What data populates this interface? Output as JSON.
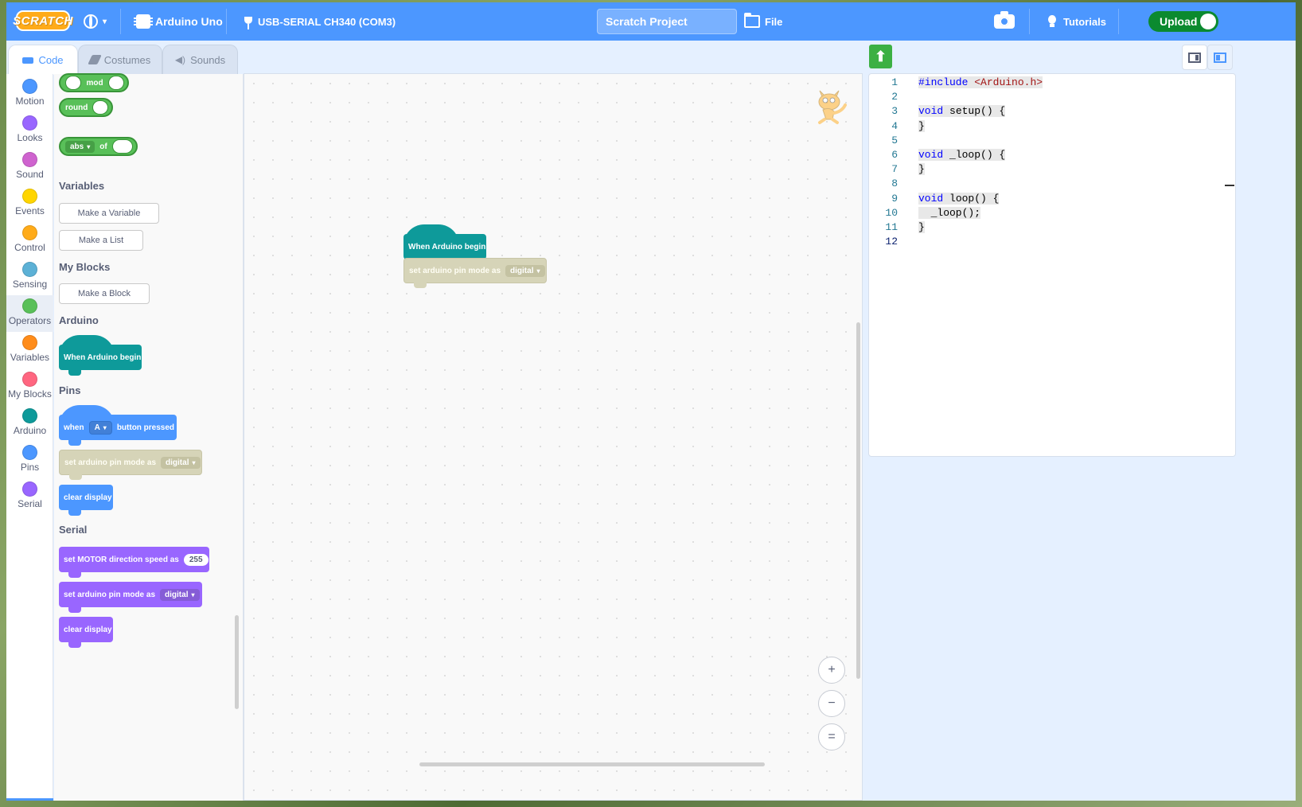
{
  "menu": {
    "logo": "SCRATCH",
    "board": "Arduino Uno",
    "port": "USB-SERIAL CH340 (COM3)",
    "project_title": "Scratch Project",
    "file": "File",
    "tutorials": "Tutorials",
    "upload": "Upload"
  },
  "tabs": {
    "code": "Code",
    "costumes": "Costumes",
    "sounds": "Sounds"
  },
  "categories": [
    {
      "label": "Motion",
      "color": "#4c97ff"
    },
    {
      "label": "Looks",
      "color": "#9966ff"
    },
    {
      "label": "Sound",
      "color": "#cf63cf"
    },
    {
      "label": "Events",
      "color": "#ffd500"
    },
    {
      "label": "Control",
      "color": "#ffab19"
    },
    {
      "label": "Sensing",
      "color": "#5cb1d6"
    },
    {
      "label": "Operators",
      "color": "#59c059"
    },
    {
      "label": "Variables",
      "color": "#ff8c1a"
    },
    {
      "label": "My Blocks",
      "color": "#ff6680"
    },
    {
      "label": "Arduino",
      "color": "#0e9a9a"
    },
    {
      "label": "Pins",
      "color": "#4c97ff"
    },
    {
      "label": "Serial",
      "color": "#9966ff"
    }
  ],
  "selected_category": "Operators",
  "flyout": {
    "operators": {
      "mod": "mod",
      "round": "round",
      "abs": "abs",
      "of": "of"
    },
    "variables": {
      "heading": "Variables",
      "make_variable": "Make a Variable",
      "make_list": "Make a List"
    },
    "my_blocks": {
      "heading": "My Blocks",
      "make_block": "Make a Block"
    },
    "arduino": {
      "heading": "Arduino",
      "when_begin": "When Arduino begin"
    },
    "pins": {
      "heading": "Pins",
      "when": "when",
      "button": "A",
      "button_pressed": "button pressed",
      "set_pin_mode": "set arduino pin mode as",
      "pin_mode_value": "digital",
      "clear_display": "clear display"
    },
    "serial": {
      "heading": "Serial",
      "motor_speed": "set MOTOR direction speed as",
      "motor_speed_value": "255",
      "set_pin_mode": "set arduino pin mode as",
      "pin_mode_value": "digital",
      "clear_display": "clear display"
    }
  },
  "workspace": {
    "hat_label": "When Arduino begin",
    "cmd_label": "set arduino pin mode as",
    "cmd_value": "digital"
  },
  "zoom": {
    "in": "+",
    "out": "−",
    "reset": "="
  },
  "code_lines": [
    {
      "n": "1",
      "text": "#include <Arduino.h>"
    },
    {
      "n": "2",
      "text": ""
    },
    {
      "n": "3",
      "text": "void setup() {"
    },
    {
      "n": "4",
      "text": "}"
    },
    {
      "n": "5",
      "text": ""
    },
    {
      "n": "6",
      "text": "void _loop() {"
    },
    {
      "n": "7",
      "text": "}"
    },
    {
      "n": "8",
      "text": ""
    },
    {
      "n": "9",
      "text": "void loop() {"
    },
    {
      "n": "10",
      "text": "  _loop();"
    },
    {
      "n": "11",
      "text": "}"
    },
    {
      "n": "12",
      "text": ""
    }
  ],
  "colors": {
    "menubar": "#4c97ff",
    "operators": "#59c059",
    "arduino": "#0e9a9a",
    "pins": "#4c97ff",
    "pins_disabled": "#d6d4b8",
    "serial": "#9966ff",
    "upload": "#0b8a2f"
  }
}
